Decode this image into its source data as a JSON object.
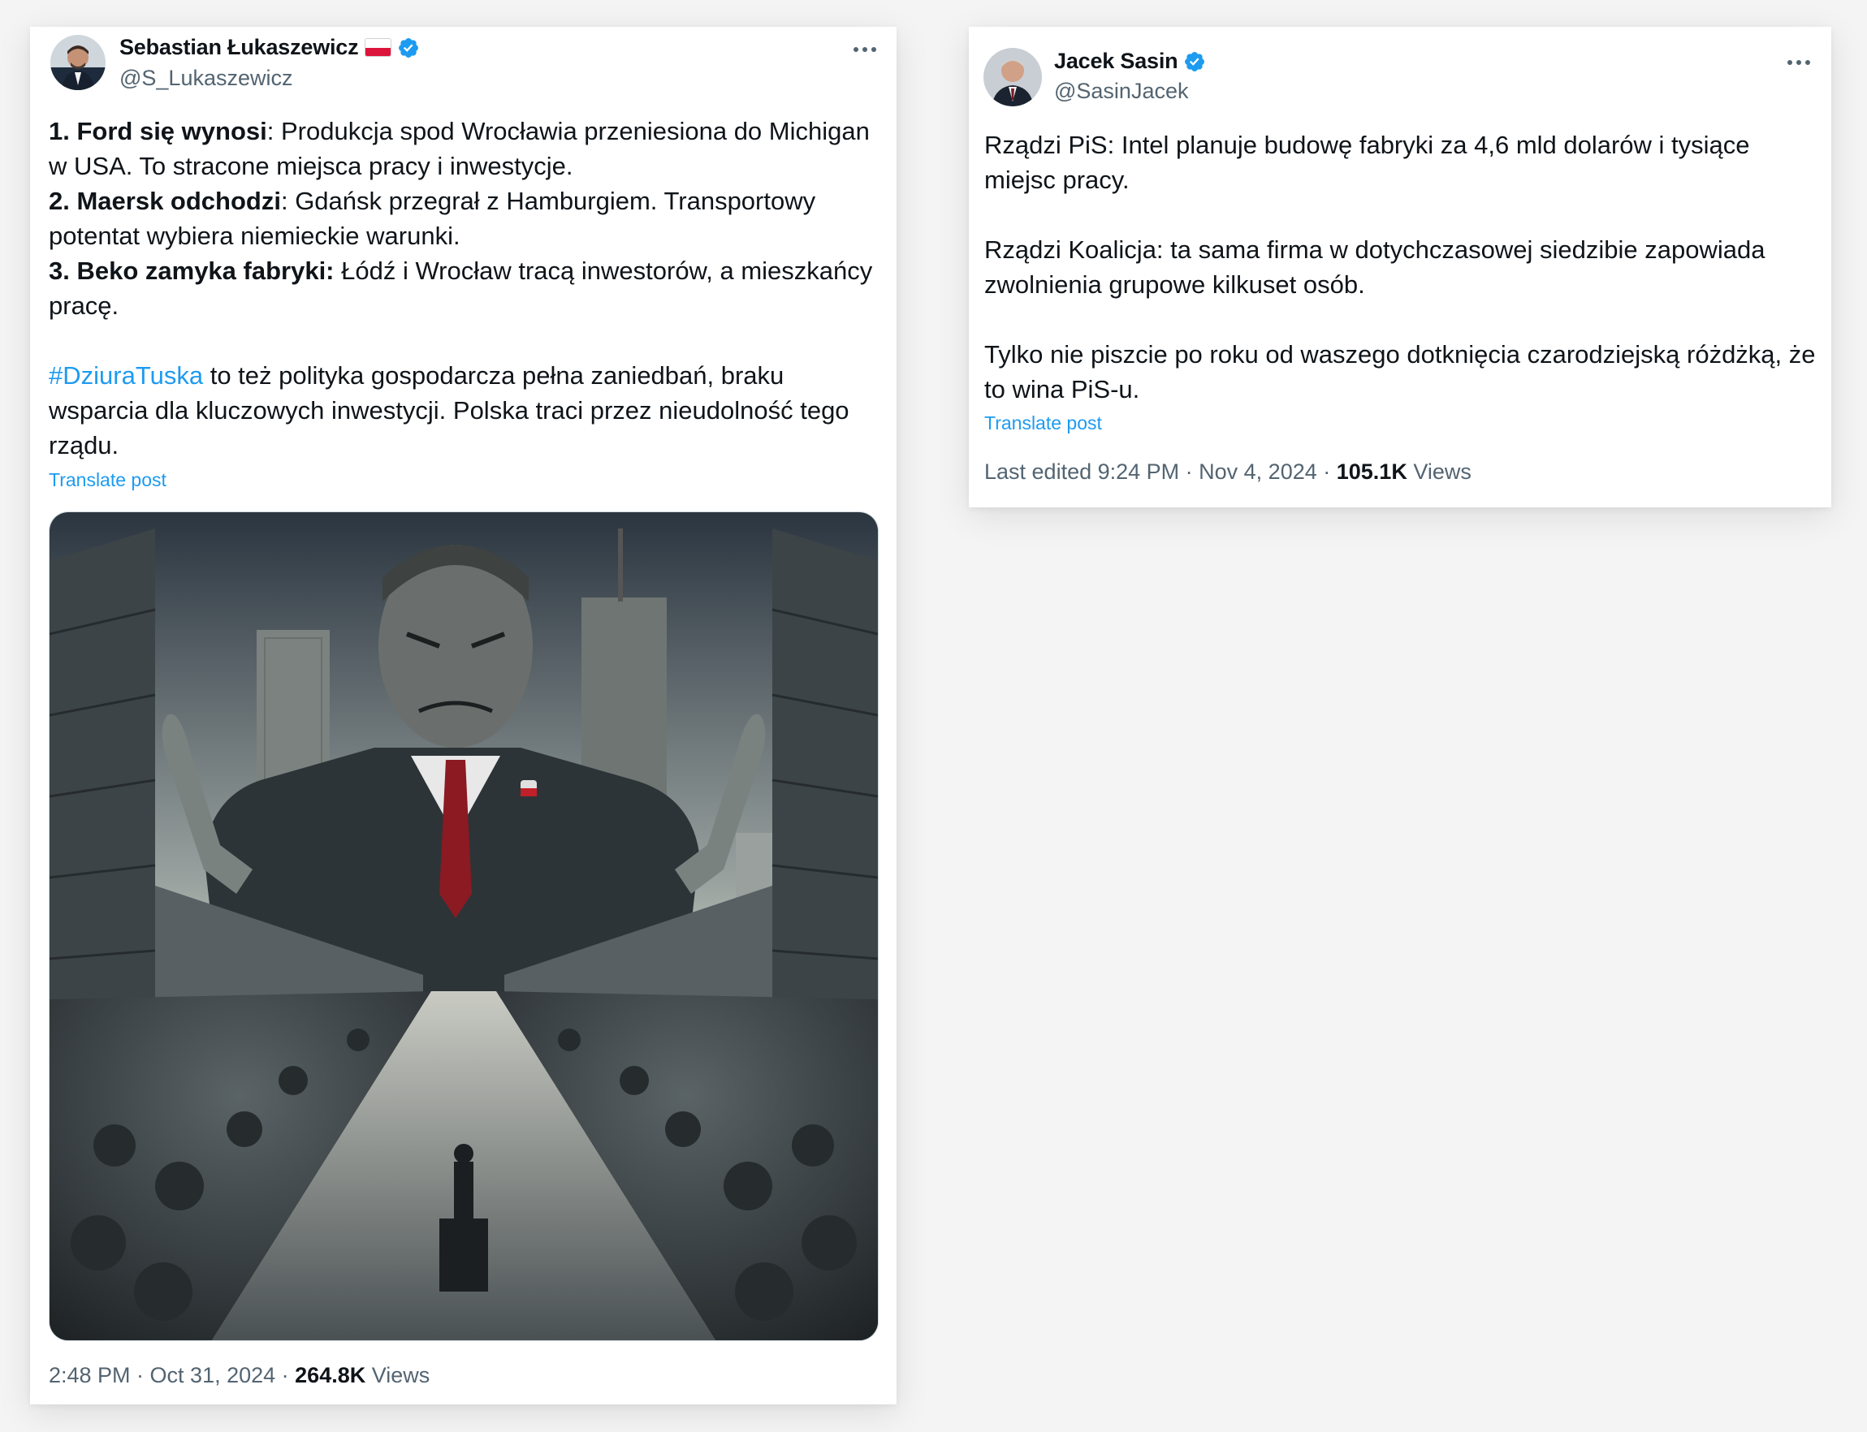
{
  "tweets": [
    {
      "author": {
        "name": "Sebastian Łukaszewicz",
        "handle": "@S_Lukaszewicz",
        "verified_icon": "verified-badge-icon",
        "flag_icon": "poland-flag-icon"
      },
      "segments": [
        {
          "bold": "1. Ford się wynosi",
          "text": ": Produkcja spod Wrocławia przeniesiona do Michigan w USA. To stracone miejsca pracy i inwestycje."
        },
        {
          "bold": "2. Maersk odchodzi",
          "text": ": Gdańsk przegrał z Hamburgiem. Transportowy potentat wybiera niemieckie warunki."
        },
        {
          "bold": "3. Beko zamyka fabryki:",
          "text": " Łódź i Wrocław tracą inwestorów, a mieszkańcy pracę."
        }
      ],
      "hashtag": "#DziuraTuska",
      "hashtag_rest": " to też polityka gospodarcza pełna zaniedbań, braku wsparcia dla kluczowych inwestycji. Polska traci przez nieudolność tego rządu.",
      "translate_label": "Translate post",
      "time": "2:48 PM · Oct 31, 2024 · ",
      "views_count": "264.8K",
      "views_label": " Views",
      "more_icon": "more-options-icon"
    },
    {
      "author": {
        "name": "Jacek Sasin",
        "handle": "@SasinJacek",
        "verified_icon": "verified-badge-icon"
      },
      "paragraphs": [
        "Rządzi PiS: Intel planuje budowę fabryki za 4,6 mld dolarów i tysiące miejsc pracy.",
        "Rządzi Koalicja: ta sama firma w dotychczasowej  siedzibie zapowiada zwolnienia grupowe kilkuset osób.",
        "Tylko nie piszcie po roku od waszego dotknięcia czarodziejską różdżką, że to wina PiS-u."
      ],
      "translate_label": "Translate post",
      "time": "Last edited 9:24 PM · Nov 4, 2024 · ",
      "views_count": "105.1K",
      "views_label": " Views",
      "more_icon": "more-options-icon"
    }
  ],
  "colors": {
    "link": "#1d9bf0",
    "secondary_text": "#536471",
    "primary_text": "#0f1419",
    "page_bg": "#f4f4f4"
  }
}
